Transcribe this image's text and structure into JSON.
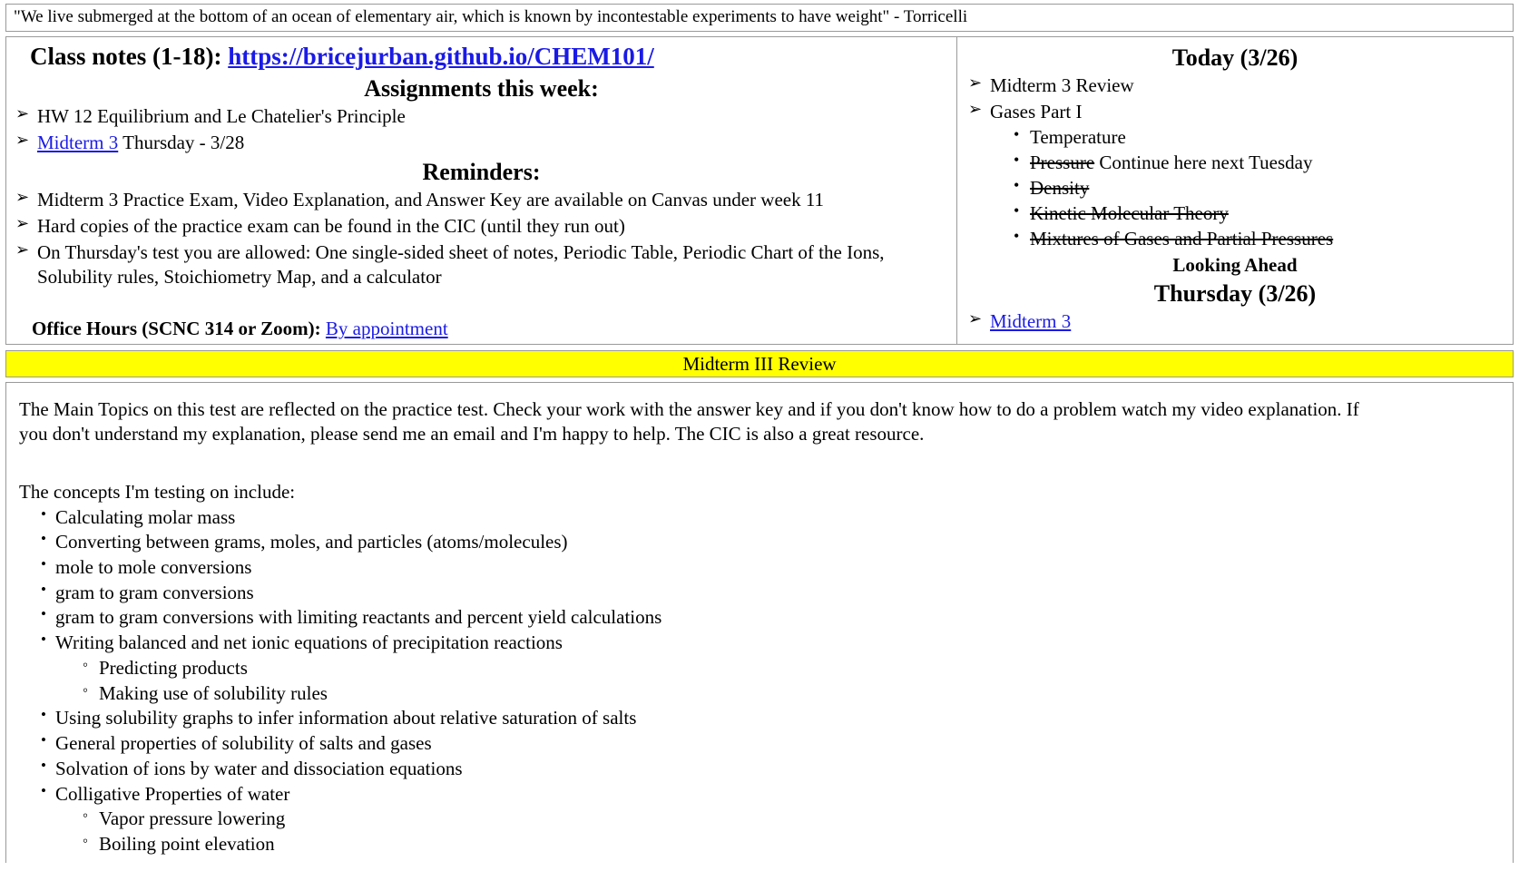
{
  "quote": {
    "text": "\"We live submerged at the bottom of an ocean of elementary air, which is known by incontestable experiments to have weight\" - Torricelli"
  },
  "left_panel": {
    "class_notes_label": "Class notes (1-18):",
    "class_notes_link": "https://bricejurban.github.io/CHEM101/",
    "assignments_heading": "Assignments this week:",
    "assignments": [
      {
        "text": "HW 12 Equilibrium and Le Chatelier's Principle",
        "link": ""
      },
      {
        "link": "Midterm 3",
        "text": " Thursday - 3/28"
      }
    ],
    "reminders_heading": "Reminders:",
    "reminders": [
      "Midterm 3 Practice Exam, Video Explanation, and Answer Key are available on Canvas under week 11",
      "Hard copies of the practice exam can be found in the CIC (until they run out)",
      "On Thursday's test you are allowed: One single-sided sheet of notes, Periodic Table, Periodic Chart of the Ions, Solubility rules, Stoichiometry Map, and a calculator"
    ],
    "office_hours_label": "Office Hours (SCNC 314 or Zoom)",
    "office_hours_sep": ": ",
    "office_hours_link": "By appointment"
  },
  "right_panel": {
    "today_heading": "Today (3/26)",
    "today_items": [
      {
        "label": "Midterm 3 Review"
      },
      {
        "label": "Gases Part I"
      }
    ],
    "gases_subitems": [
      {
        "label": "Temperature",
        "struck": false,
        "note": ""
      },
      {
        "label": "Pressure",
        "struck": true,
        "note": " Continue here next Tuesday"
      },
      {
        "label": "Density",
        "struck": true,
        "note": ""
      },
      {
        "label": "Kinetic Molecular Theory",
        "struck": true,
        "note": ""
      },
      {
        "label": "Mixtures of Gases and Partial Pressures",
        "struck": true,
        "note": ""
      }
    ],
    "looking_ahead_heading": "Looking Ahead",
    "thursday_heading": "Thursday (3/26)",
    "thursday_items": [
      {
        "link": "Midterm 3"
      }
    ]
  },
  "banner": {
    "title": "Midterm III Review",
    "background_color": "#ffff00"
  },
  "main": {
    "intro_paragraph": "The Main Topics on this test are reflected on the practice test. Check your work with the answer key and if you don't know how to do a problem watch my video explanation. If you don't understand my explanation, please send me an email and I'm happy to help. The CIC is also a great resource.",
    "concepts_lead": "The concepts I'm testing on include:",
    "concepts": [
      {
        "label": "Calculating molar mass",
        "subs": []
      },
      {
        "label": "Converting between grams, moles, and particles (atoms/molecules)",
        "subs": []
      },
      {
        "label": "mole to mole conversions",
        "subs": []
      },
      {
        "label": "gram to gram conversions",
        "subs": []
      },
      {
        "label": "gram to gram conversions with limiting reactants and percent yield calculations",
        "subs": []
      },
      {
        "label": "Writing balanced and net ionic equations of precipitation reactions",
        "subs": [
          "Predicting products",
          "Making use of solubility rules"
        ]
      },
      {
        "label": "Using solubility graphs to infer information about relative saturation of salts",
        "subs": []
      },
      {
        "label": "General properties of solubility of salts and gases",
        "subs": []
      },
      {
        "label": "Solvation of ions by water and dissociation equations",
        "subs": []
      },
      {
        "label": "Colligative Properties of water",
        "subs": [
          "Vapor pressure lowering",
          "Boiling point elevation"
        ]
      }
    ]
  },
  "colors": {
    "link": "#1a1ae6",
    "banner": "#ffff00",
    "border": "#9a9a9a"
  }
}
